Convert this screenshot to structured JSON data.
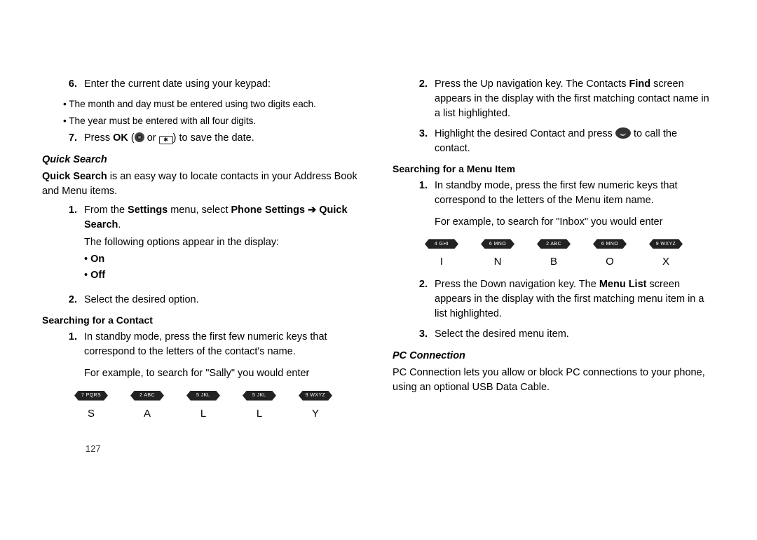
{
  "left": {
    "step6": {
      "num": "6.",
      "text": "Enter the current date using your keypad:",
      "sub1": "The month and day must be entered using two digits each.",
      "sub2": "The year must be entered with all four digits."
    },
    "step7": {
      "num": "7.",
      "lead": "Press ",
      "ok": "OK",
      "mid": " (",
      "or": " or ",
      "tail": " to save the date."
    },
    "quick_search_hdr": "Quick Search",
    "quick_search_para_lead": "Quick Search",
    "quick_search_para_tail": " is an easy way to locate contacts in your Address Book and Menu items.",
    "qs_step1": {
      "num": "1.",
      "lead": "From the ",
      "b1": "Settings",
      "mid1": " menu, select ",
      "b2": "Phone Settings ➔ Quick Search",
      "tail": ".",
      "line2": "The following options appear in the display:",
      "opt1": "On",
      "opt2": "Off"
    },
    "qs_step2": {
      "num": "2.",
      "text": "Select the desired option."
    },
    "contact_hdr": "Searching for a Contact",
    "c_step1": {
      "num": "1.",
      "l1": "In standby mode, press the first few numeric keys that correspond to the letters of the contact's name.",
      "l2": "For example, to search for \"Sally\" you would enter"
    },
    "keys_sally": [
      "7 PQRS",
      "2 ABC",
      "5 JKL",
      "5 JKL",
      "9 WXYZ"
    ],
    "letters_sally": [
      "S",
      "A",
      "L",
      "L",
      "Y"
    ]
  },
  "right": {
    "c_step2": {
      "num": "2.",
      "lead": "Press the Up navigation key. The Contacts ",
      "b1": "Find",
      "tail": " screen appears in the display with the first matching contact name in a list highlighted."
    },
    "c_step3": {
      "num": "3.",
      "lead": "Highlight the desired Contact and press ",
      "tail": " to call the contact."
    },
    "menu_hdr": "Searching for a Menu Item",
    "m_step1": {
      "num": "1.",
      "l1": "In standby mode, press the first few numeric keys that correspond to the letters of the Menu item name.",
      "l2": "For example, to search for \"Inbox\" you would enter"
    },
    "keys_inbox": [
      "4 GHI",
      "6 MNO",
      "2 ABC",
      "6 MNO",
      "9 WXYZ"
    ],
    "letters_inbox": [
      "I",
      "N",
      "B",
      "O",
      "X"
    ],
    "m_step2": {
      "num": "2.",
      "lead": "Press the Down navigation key. The ",
      "b1": "Menu List",
      "tail": " screen appears in the display with the first matching menu item in a list highlighted."
    },
    "m_step3": {
      "num": "3.",
      "text": "Select the desired menu item."
    },
    "pc_hdr": "PC Connection",
    "pc_para": "PC Connection lets you allow or block PC connections to your phone, using an optional USB Data Cable."
  },
  "page_number": "127"
}
